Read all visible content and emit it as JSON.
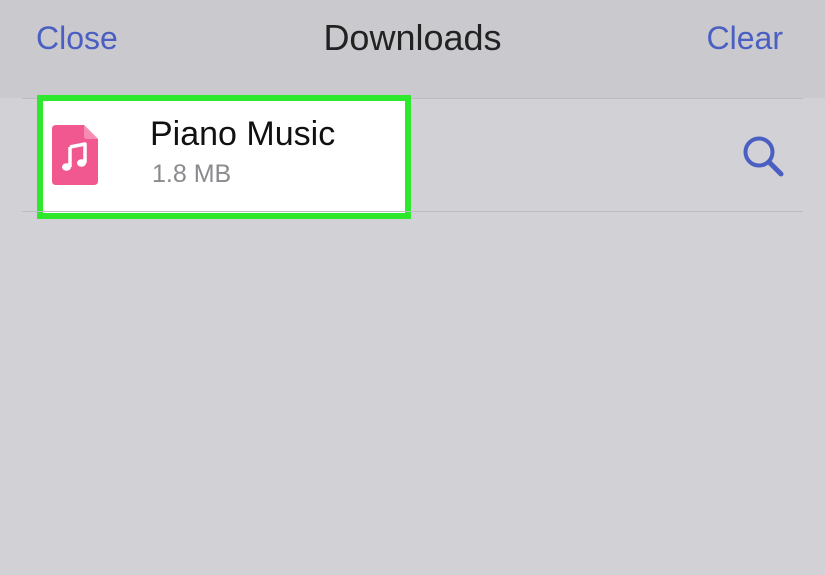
{
  "header": {
    "close_label": "Close",
    "title": "Downloads",
    "clear_label": "Clear"
  },
  "downloads": [
    {
      "name": "Piano Music",
      "size": "1.8 MB",
      "icon": "music-file-icon"
    }
  ],
  "row_action_icon": "search-icon",
  "colors": {
    "accent": "#4a5fc1",
    "highlight": "#2ee82e",
    "file_icon": "#f0588f",
    "background": "#d1d1d6"
  }
}
